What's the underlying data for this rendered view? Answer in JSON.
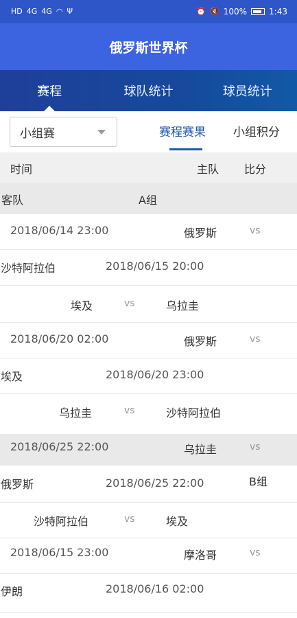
{
  "status_bar": {
    "left_icons": [
      "HD",
      "4G",
      "4G",
      "wifi",
      "usb"
    ],
    "battery": "100%",
    "time": "1:43"
  },
  "app_bar": {
    "title": "俄罗斯世界杯"
  },
  "top_tabs": [
    {
      "label": "赛程",
      "active": true
    },
    {
      "label": "球队统计",
      "active": false
    },
    {
      "label": "球员统计",
      "active": false
    }
  ],
  "filter": {
    "dropdown_value": "小组赛",
    "subtabs": [
      {
        "label": "赛程赛果",
        "active": true
      },
      {
        "label": "小组积分",
        "active": false
      }
    ]
  },
  "table_header": {
    "time": "时间",
    "home": "主队",
    "score": "比分"
  },
  "rows": [
    {
      "texts": [
        "客队",
        "A组"
      ]
    },
    {
      "texts": [
        "2018/06/14 23:00",
        "俄罗斯",
        "vs"
      ]
    },
    {
      "texts": [
        "沙特阿拉伯",
        "2018/06/15 20:00"
      ]
    },
    {
      "texts": [
        "埃及",
        "vs",
        "乌拉圭"
      ]
    },
    {
      "texts": [
        "2018/06/20 02:00",
        "俄罗斯",
        "vs"
      ]
    },
    {
      "texts": [
        "埃及",
        "2018/06/20 23:00"
      ]
    },
    {
      "texts": [
        "乌拉圭",
        "vs",
        "沙特阿拉伯"
      ]
    },
    {
      "texts": [
        "2018/06/25 22:00",
        "乌拉圭",
        "vs"
      ]
    },
    {
      "texts": [
        "俄罗斯",
        "2018/06/25 22:00",
        "B组"
      ]
    },
    {
      "texts": [
        "沙特阿拉伯",
        "vs",
        "埃及"
      ]
    },
    {
      "texts": [
        "2018/06/15 23:00",
        "摩洛哥",
        "vs"
      ]
    },
    {
      "texts": [
        "伊朗",
        "2018/06/16 02:00"
      ]
    }
  ]
}
